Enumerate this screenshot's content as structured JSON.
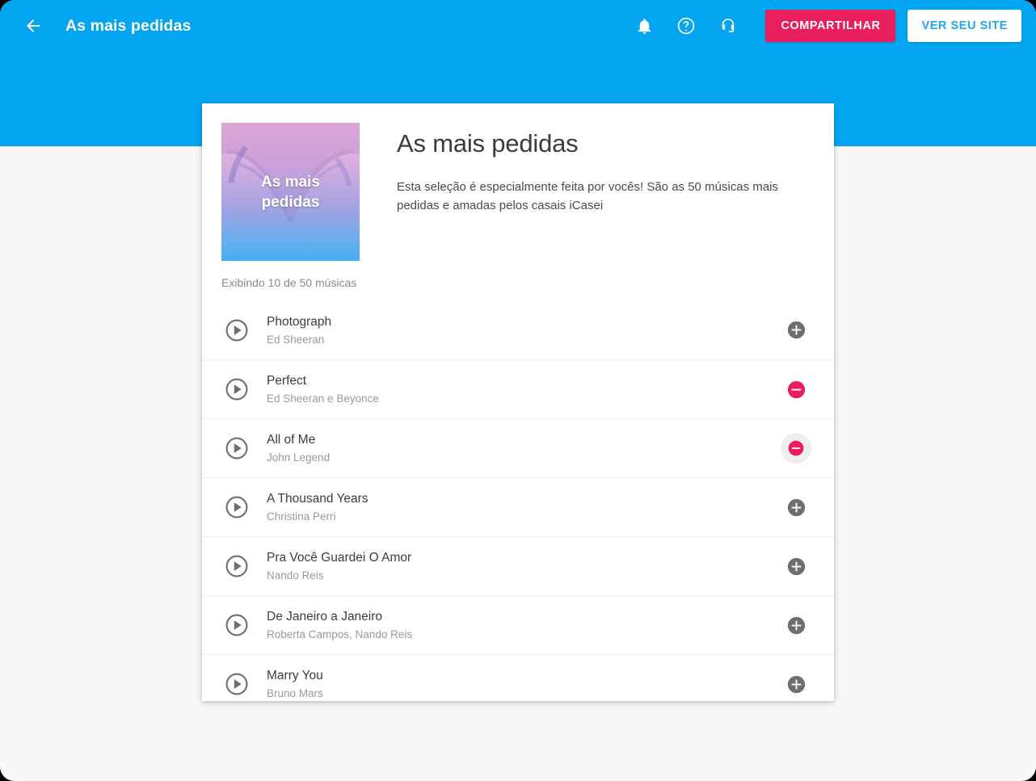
{
  "appbar": {
    "back_icon": "arrow-back-icon",
    "title": "As mais pedidas",
    "icons": [
      {
        "name": "notifications-bell-icon",
        "label": "Notificações"
      },
      {
        "name": "help-circle-icon",
        "label": "Ajuda"
      },
      {
        "name": "support-headset-icon",
        "label": "Suporte"
      }
    ],
    "share_label": "COMPARTILHAR",
    "site_label": "VER SEU SITE",
    "colors": {
      "header_blue": "#03a5f0",
      "share_pink": "#e91e5f",
      "site_text_blue": "#1fa8f0"
    }
  },
  "card": {
    "cover_label": "As mais\npedidas",
    "cover_line1": "As mais",
    "cover_line2": "pedidas",
    "title": "As mais pedidas",
    "description": "Esta seleção é especialmente feita por vocês! São as 50 músicas mais pedidas e amadas pelos casais iCasei",
    "count_text": "Exibindo 10 de 50 músicas"
  },
  "songs": [
    {
      "title": "Photograph",
      "artist": "Ed Sheeran",
      "action": "add",
      "action_icon": "plus-circle-icon",
      "hovered": false
    },
    {
      "title": "Perfect",
      "artist": "Ed Sheeran e Beyonce",
      "action": "remove",
      "action_icon": "minus-circle-icon",
      "hovered": false
    },
    {
      "title": "All of Me",
      "artist": "John Legend",
      "action": "remove",
      "action_icon": "minus-circle-icon",
      "hovered": true
    },
    {
      "title": "A Thousand Years",
      "artist": "Christina Perri",
      "action": "add",
      "action_icon": "plus-circle-icon",
      "hovered": false
    },
    {
      "title": "Pra Você Guardei O Amor",
      "artist": "Nando Reis",
      "action": "add",
      "action_icon": "plus-circle-icon",
      "hovered": false
    },
    {
      "title": "De Janeiro a Janeiro",
      "artist": "Roberta Campos, Nando Reis",
      "action": "add",
      "action_icon": "plus-circle-icon",
      "hovered": false
    },
    {
      "title": "Marry You",
      "artist": "Bruno Mars",
      "action": "add",
      "action_icon": "plus-circle-icon",
      "hovered": false
    }
  ],
  "colors": {
    "page_bg": "#f8f8f8",
    "card_bg": "#ffffff",
    "play_gray": "#6e6e6e",
    "add_gray": "#6e6e6e",
    "remove_pink": "#e91e5f"
  }
}
